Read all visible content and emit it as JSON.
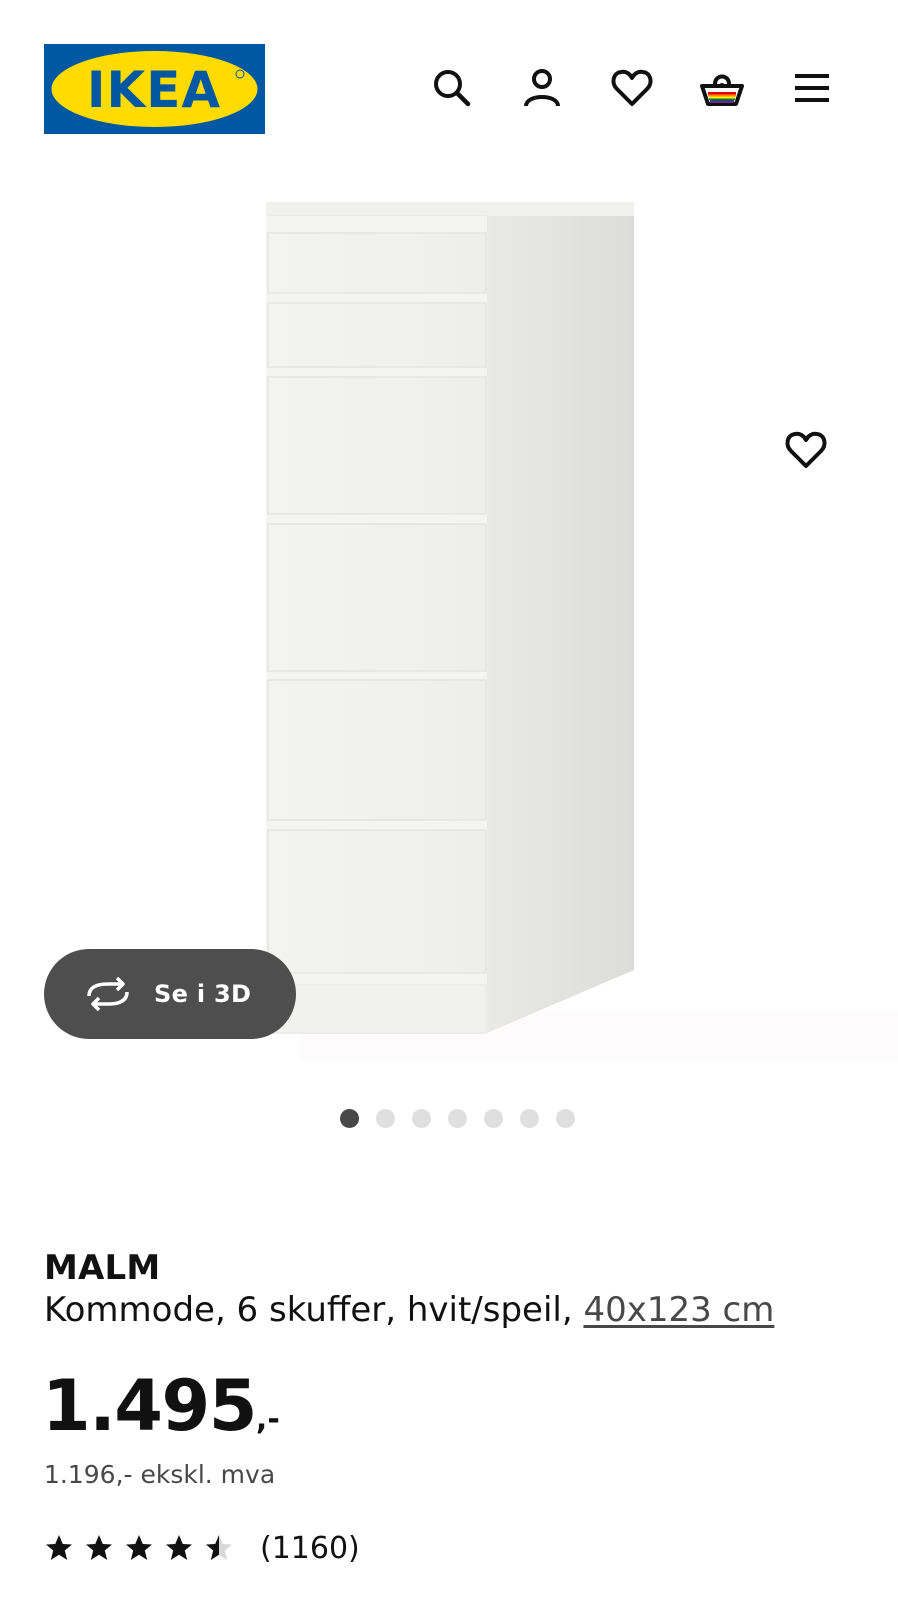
{
  "header": {
    "logo_text": "IKEA",
    "icons": [
      "search-icon",
      "account-icon",
      "heart-icon",
      "basket-icon",
      "menu-icon"
    ]
  },
  "colors": {
    "ikea_blue": "#0058a3",
    "ikea_yellow": "#ffdb00",
    "button_dark": "#4e4e4e",
    "dot_active": "#484848",
    "dot_inactive": "#dfdfdf"
  },
  "gallery": {
    "view_3d_label": "Se i 3D",
    "image_count": 7,
    "active_index": 0
  },
  "product": {
    "name": "MALM",
    "description": "Kommode, 6 skuffer, hvit/speil, ",
    "size_link": "40x123 cm",
    "price_integer": "1.495",
    "price_suffix": ",-",
    "price_excl_vat": "1.196,- ekskl. mva",
    "rating": 4.5,
    "rating_max": 5,
    "review_count": "(1160)"
  }
}
